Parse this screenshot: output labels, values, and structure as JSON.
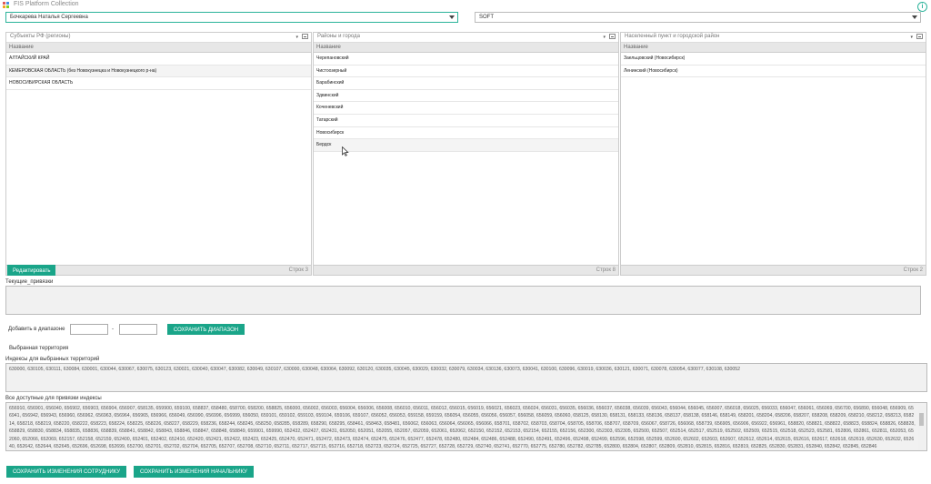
{
  "app": {
    "title": "FIS Platform Collection",
    "info_symbol": "i"
  },
  "top": {
    "user_value": "Бочкарева Наталья Сергеевна",
    "soft_value": "SOFT"
  },
  "panels": {
    "regions": {
      "header": "Субъекты РФ (регионы)",
      "column": "Название",
      "rows": [
        "АЛТАЙСКИЙ КРАЙ",
        "КЕМЕРОВСКАЯ ОБЛАСТЬ (без Новокузнецка и Новокузнецкого р-на)",
        "НОВОСИБИРСКАЯ ОБЛАСТЬ"
      ],
      "footer": "Строк 3"
    },
    "districts": {
      "header": "Районы и города",
      "column": "Название",
      "rows": [
        "Черепановский",
        "Чистоозерный",
        "Барабинский",
        "Здвинский",
        "Коченевский",
        "Татарский",
        "Новосибирск",
        "Бердск"
      ],
      "footer": "Строк 8"
    },
    "settlements": {
      "header": "Населенный пункт и городской район",
      "column": "Название",
      "rows": [
        "Заельцовский (Новосибирск)",
        "Ленинский (Новосибирск)"
      ],
      "footer": "Строк 2"
    },
    "dropdown_glyph": "▾"
  },
  "actions": {
    "edit": "Редактировать",
    "current_bindings": "Текущие_привязки",
    "add_range": "Добавить в диапазоне",
    "range_dash": "-",
    "save_range": "СОХРАНИТЬ ДИАПАЗОН",
    "selected_territory": "Выбранная территория",
    "indexes_selected_label": "Индексы для выбранных территорий",
    "indexes_selected": "630000, 630105, 630111, 630084, 630001, 630044, 630067, 630075, 630123, 630021, 630040, 630047, 630082, 630049, 630107, 630000, 630048, 630064, 630092, 630120, 630035, 630045, 630029, 630032, 630079, 630034, 630136, 630073, 630041, 630100, 630096, 630019, 630036, 630121, 630071, 630078, 630054, 630077, 630108, 630052",
    "all_available_label": "Все доступные для привязки индексы",
    "all_available": "656910, 656901, 656040, 656902, 656903, 656904, 656907, 658135, 659900, 659100, 658837, 658480, 658700, 658200, 658825, 656000, 656002, 656003, 656004, 656006, 656008, 656010, 656011, 656012, 656015, 656019, 656021, 656023, 656024, 656031, 656035, 656036, 656037, 656038, 656039, 656043, 656044, 656045, 656007, 656018, 656025, 656033, 656047, 656061, 656069, 656700, 656890, 656048, 656909, 656941, 656942, 656943, 656960, 656962, 656963, 656964, 656965, 656966, 656049, 656990, 656996, 656999, 656050, 659101, 659102, 659103, 659104, 659106, 659107, 656052, 656053, 659158, 659159, 656054, 656055, 656056, 656057, 656058, 656059, 656060, 658125, 658130, 658131, 658133, 658136, 658137, 658138, 658146, 658149, 658201, 658204, 658206, 658207, 658208, 658209, 658210, 658212, 658213, 658214, 658218, 658219, 658220, 658222, 658223, 658224, 658225, 658226, 658227, 658229, 658236, 658244, 658245, 658250, 658285, 658289, 658290, 658295, 658461, 658463, 658481, 656062, 656063, 656064, 656065, 656066, 658701, 658702, 658703, 658704, 658705, 658706, 658707, 658709, 656067, 658726, 656068, 658739, 656905, 656906, 656922, 656961, 658820, 658821, 658822, 658823, 658824, 658826, 658828, 658829, 658830, 658834, 658835, 658836, 658839, 658841, 658842, 658843, 658846, 658847, 658848, 658849, 659901, 659990, 652432, 652427, 652431, 652050, 652051, 652055, 652057, 652059, 652061, 652062, 652150, 652152, 652153, 652154, 652155, 652156, 652300, 652303, 652305, 652500, 652507, 652514, 652517, 652519, 652502, 652509, 652515, 652518, 652523, 652581, 652806, 652861, 652811, 652053, 652060, 652066, 652069, 652157, 652158, 652159, 652400, 652401, 652402, 652410, 652420, 652421, 652422, 652423, 652425, 652470, 652471, 652472, 652473, 652474, 652475, 652476, 652477, 652478, 652480, 652484, 652486, 652488, 652490, 652491, 652496, 652498, 652499, 652596, 652598, 652599, 652600, 652602, 652603, 652607, 652612, 652614, 652615, 652616, 652617, 652618, 652619, 652630, 652632, 652640, 652642, 652644, 652645, 652696, 652698, 652699, 652700, 652701, 652702, 652704, 652705, 652707, 652708, 652710, 652711, 652717, 652715, 652716, 652718, 652723, 652724, 652725, 652727, 652728, 652729, 652740, 652741, 652770, 652775, 652780, 652782, 652785, 652800, 652804, 652807, 652809, 652810, 652815, 652816, 652819, 652825, 652830, 652831, 652840, 652842, 652845, 652846",
    "save_employee": "СОХРАНИТЬ ИЗМЕНЕНИЯ СОТРУДНИКУ",
    "save_manager": "СОХРАНИТЬ ИЗМЕНЕНИЯ НАЧАЛЬНИКУ"
  },
  "colors": {
    "accent": "#1aa589",
    "brand_teal": "#2bb39a"
  }
}
